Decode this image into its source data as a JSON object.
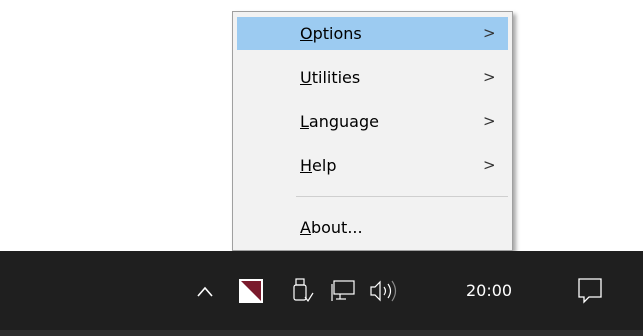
{
  "context_menu": {
    "items": [
      {
        "mnemonic": "O",
        "rest": "ptions",
        "arrow": ">"
      },
      {
        "mnemonic": "U",
        "rest": "tilities",
        "arrow": ">"
      },
      {
        "mnemonic": "L",
        "rest": "anguage",
        "arrow": ">"
      },
      {
        "mnemonic": "H",
        "rest": "elp",
        "arrow": ">"
      },
      {
        "mnemonic": "A",
        "rest": "bout...",
        "arrow": ""
      }
    ],
    "highlight_color": "#9ccbf1"
  },
  "taskbar": {
    "clock": "20:00",
    "icons": [
      "chevron-up-icon",
      "app-tray-icon",
      "usb-drive-icon",
      "network-icon",
      "speaker-icon",
      "notification-icon"
    ],
    "background_color": "#1f1f1f",
    "app_icon_color": "#7a1a2c"
  }
}
